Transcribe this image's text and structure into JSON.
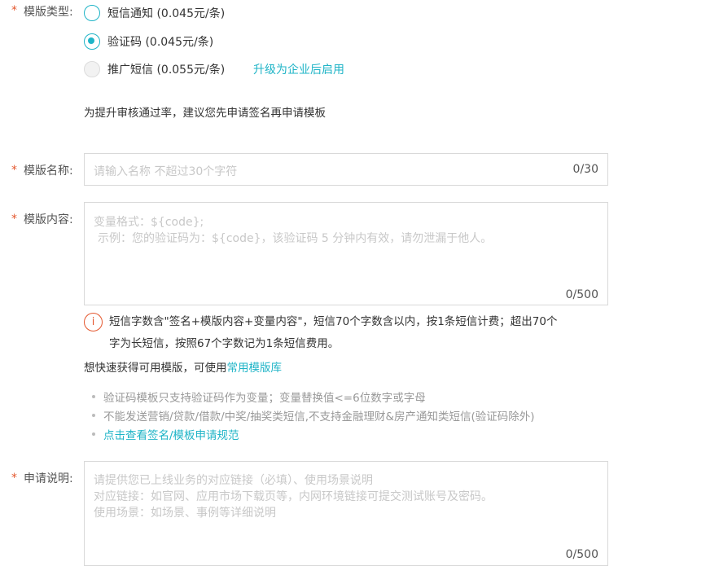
{
  "template_type": {
    "label": "模版类型:",
    "options": [
      {
        "label": "短信通知 (0.045元/条)",
        "state": "unchecked"
      },
      {
        "label": "验证码 (0.045元/条)",
        "state": "checked"
      },
      {
        "label": "推广短信 (0.055元/条)",
        "state": "disabled"
      }
    ],
    "upgrade_link": "升级为企业后启用",
    "hint": "为提升审核通过率，建议您先申请签名再申请模板"
  },
  "template_name": {
    "label": "模版名称:",
    "placeholder": "请输入名称 不超过30个字符",
    "counter": "0/30"
  },
  "template_content": {
    "label": "模版内容:",
    "placeholder_line1": "变量格式：${code};",
    "placeholder_line2": "示例：您的验证码为：${code}，该验证码 5 分钟内有效，请勿泄漏于他人。",
    "counter": "0/500",
    "warning_line1": "短信字数含\"签名+模版内容+变量内容\"，短信70个字数含以内，按1条短信计费；超出70个",
    "warning_line2": "字为长短信，按照67个字数记为1条短信费用。",
    "quick_text": "想快速获得可用模版，可使用",
    "quick_link": "常用模版库",
    "tips": [
      "验证码模板只支持验证码作为变量；变量替换值<=6位数字或字母",
      "不能发送营销/贷款/借款/中奖/抽奖类短信,不支持金融理财&房产通知类短信(验证码除外)"
    ],
    "rules_link": "点击查看签名/模板申请规范"
  },
  "application_note": {
    "label": "申请说明:",
    "placeholder_line1": "请提供您已上线业务的对应链接（必填）、使用场景说明",
    "placeholder_line2": "对应链接：如官网、应用市场下载页等，内网环境链接可提交测试账号及密码。",
    "placeholder_line3": "使用场景：如场景、事例等详细说明",
    "counter": "0/500"
  },
  "required_mark": "*",
  "colors": {
    "accent": "#1fb4c7",
    "required": "#e4572e",
    "warning_icon": "#e4572e"
  },
  "icons": {
    "warning": "info-circle-icon"
  }
}
